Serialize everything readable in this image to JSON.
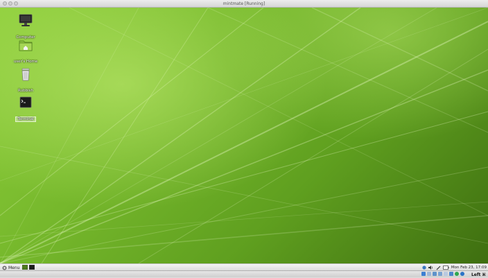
{
  "window": {
    "title": "mintmate [Running]"
  },
  "desktop": {
    "icons": [
      {
        "label": "Computer",
        "icon": "computer-icon"
      },
      {
        "label": "user's Home",
        "icon": "home-folder-icon"
      },
      {
        "label": "Rubbish",
        "icon": "trash-icon"
      },
      {
        "label": "Terminal",
        "icon": "terminal-icon"
      }
    ]
  },
  "panel": {
    "menu_label": "Menu",
    "clock": "Mon Feb 23, 17:09",
    "tray_icons": [
      "network-icon",
      "volume-icon",
      "pen-icon",
      "battery-icon"
    ]
  },
  "vbox_status": {
    "host_key": "Left ⌘",
    "icons": [
      "hard-disk-icon",
      "optical-drive-icon",
      "usb-icon",
      "shared-folder-icon",
      "display-icon",
      "network-adapter-icon",
      "capture-icon",
      "arrow-down-icon"
    ]
  },
  "colors": {
    "accent": "#7ac231",
    "panel": "#e8e8e8"
  }
}
